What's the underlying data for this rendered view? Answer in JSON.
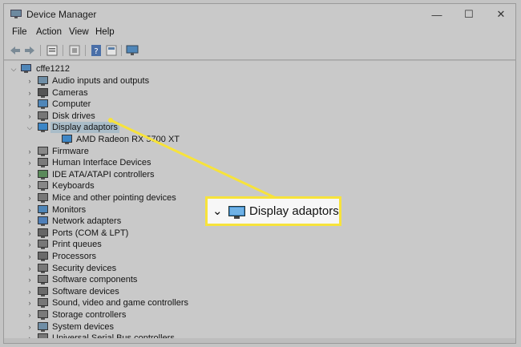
{
  "window": {
    "title": "Device Manager"
  },
  "title_controls": {
    "minimize": "—",
    "maximize": "☐",
    "close": "✕"
  },
  "menu": [
    "File",
    "Action",
    "View",
    "Help"
  ],
  "tree": {
    "root": "cffe1212",
    "items": [
      {
        "label": "Audio inputs and outputs",
        "icon": "speaker-icon",
        "expanded": false
      },
      {
        "label": "Cameras",
        "icon": "camera-icon",
        "expanded": false
      },
      {
        "label": "Computer",
        "icon": "computer-icon",
        "expanded": false
      },
      {
        "label": "Disk drives",
        "icon": "disk-drive-icon",
        "expanded": false
      },
      {
        "label": "Display adaptors",
        "icon": "display-adapter-icon",
        "expanded": true,
        "selected": true
      },
      {
        "label": "AMD Radeon RX 5700 XT",
        "icon": "display-adapter-icon",
        "child": true
      },
      {
        "label": "Firmware",
        "icon": "firmware-icon",
        "expanded": false
      },
      {
        "label": "Human Interface Devices",
        "icon": "hid-icon",
        "expanded": false
      },
      {
        "label": "IDE ATA/ATAPI controllers",
        "icon": "ide-controller-icon",
        "expanded": false
      },
      {
        "label": "Keyboards",
        "icon": "keyboard-icon",
        "expanded": false
      },
      {
        "label": "Mice and other pointing devices",
        "icon": "mouse-icon",
        "expanded": false
      },
      {
        "label": "Monitors",
        "icon": "monitor-icon",
        "expanded": false
      },
      {
        "label": "Network adapters",
        "icon": "network-adapter-icon",
        "expanded": false
      },
      {
        "label": "Ports (COM & LPT)",
        "icon": "port-icon",
        "expanded": false
      },
      {
        "label": "Print queues",
        "icon": "printer-icon",
        "expanded": false
      },
      {
        "label": "Processors",
        "icon": "processor-icon",
        "expanded": false
      },
      {
        "label": "Security devices",
        "icon": "security-device-icon",
        "expanded": false
      },
      {
        "label": "Software components",
        "icon": "software-component-icon",
        "expanded": false
      },
      {
        "label": "Software devices",
        "icon": "software-device-icon",
        "expanded": false
      },
      {
        "label": "Sound, video and game controllers",
        "icon": "sound-controller-icon",
        "expanded": false
      },
      {
        "label": "Storage controllers",
        "icon": "storage-controller-icon",
        "expanded": false
      },
      {
        "label": "System devices",
        "icon": "system-device-icon",
        "expanded": false
      },
      {
        "label": "Universal Serial Bus controllers",
        "icon": "usb-controller-icon",
        "expanded": false
      }
    ]
  },
  "callout": {
    "label": "Display adaptors",
    "icon": "display-adapter-icon",
    "highlight_color": "#f7e33b"
  }
}
